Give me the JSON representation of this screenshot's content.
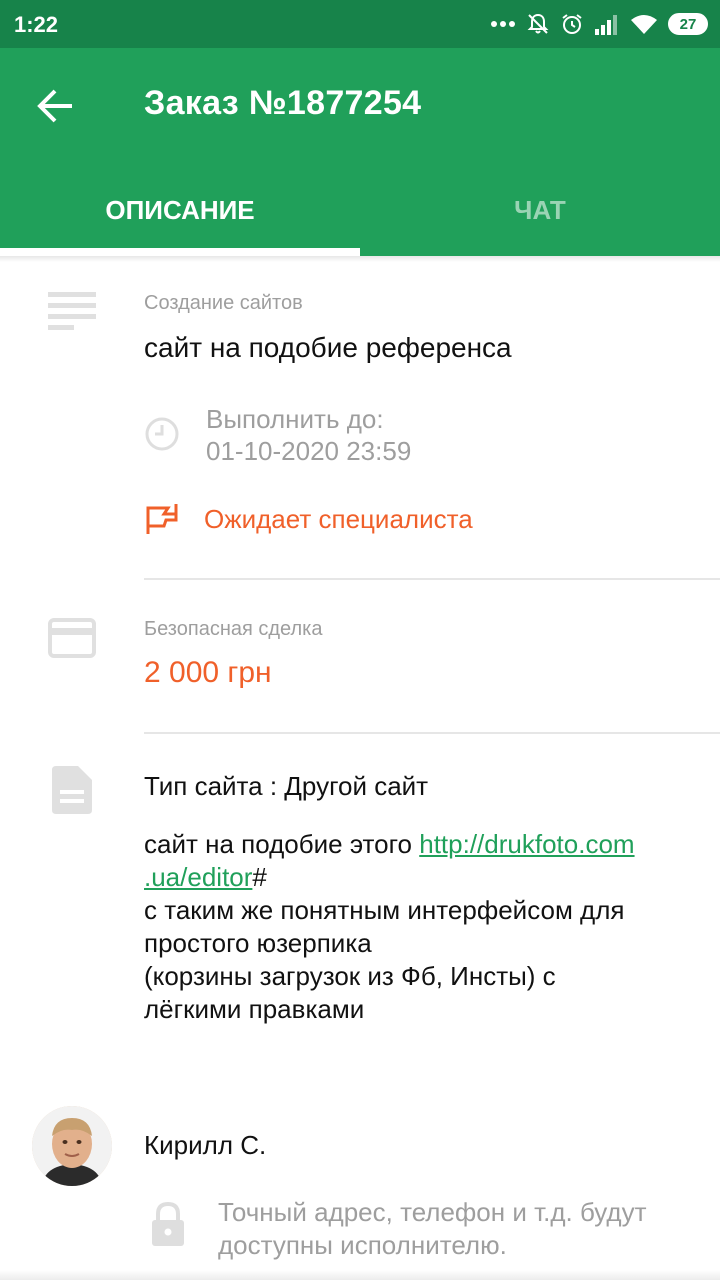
{
  "status_bar": {
    "time": "1:22",
    "battery": "27"
  },
  "header": {
    "title": "Заказ №1877254"
  },
  "tabs": [
    {
      "label": "ОПИСАНИЕ",
      "active": true
    },
    {
      "label": "ЧАТ",
      "active": false
    }
  ],
  "order": {
    "category": "Создание сайтов",
    "name": "сайт на подобие референса",
    "deadline_label": "Выполнить до:",
    "deadline_value": "01-10-2020 23:59",
    "status": "Ожидает специалиста"
  },
  "payment": {
    "label": "Безопасная сделка",
    "price": "2 000 грн"
  },
  "description": {
    "site_type": "Тип сайта : Другой сайт",
    "line1_prefix": "сайт на подобие этого ",
    "link_part1": "http://drukfoto.com",
    "link_part2": ".ua/editor",
    "link_suffix": "#",
    "line3": "с таким же понятным интерфейсом для",
    "line4": "простого юзерпика",
    "line5": "(корзины загрузок из Фб, Инсты) с",
    "line6": "лёгкими правками"
  },
  "client": {
    "name": "Кирилл С.",
    "privacy_line1": "Точный адрес, телефон и т.д. будут",
    "privacy_line2": "доступны исполнителю."
  },
  "colors": {
    "primary": "#20a05a",
    "status_bar": "#17834a",
    "accent": "#f0602a"
  }
}
